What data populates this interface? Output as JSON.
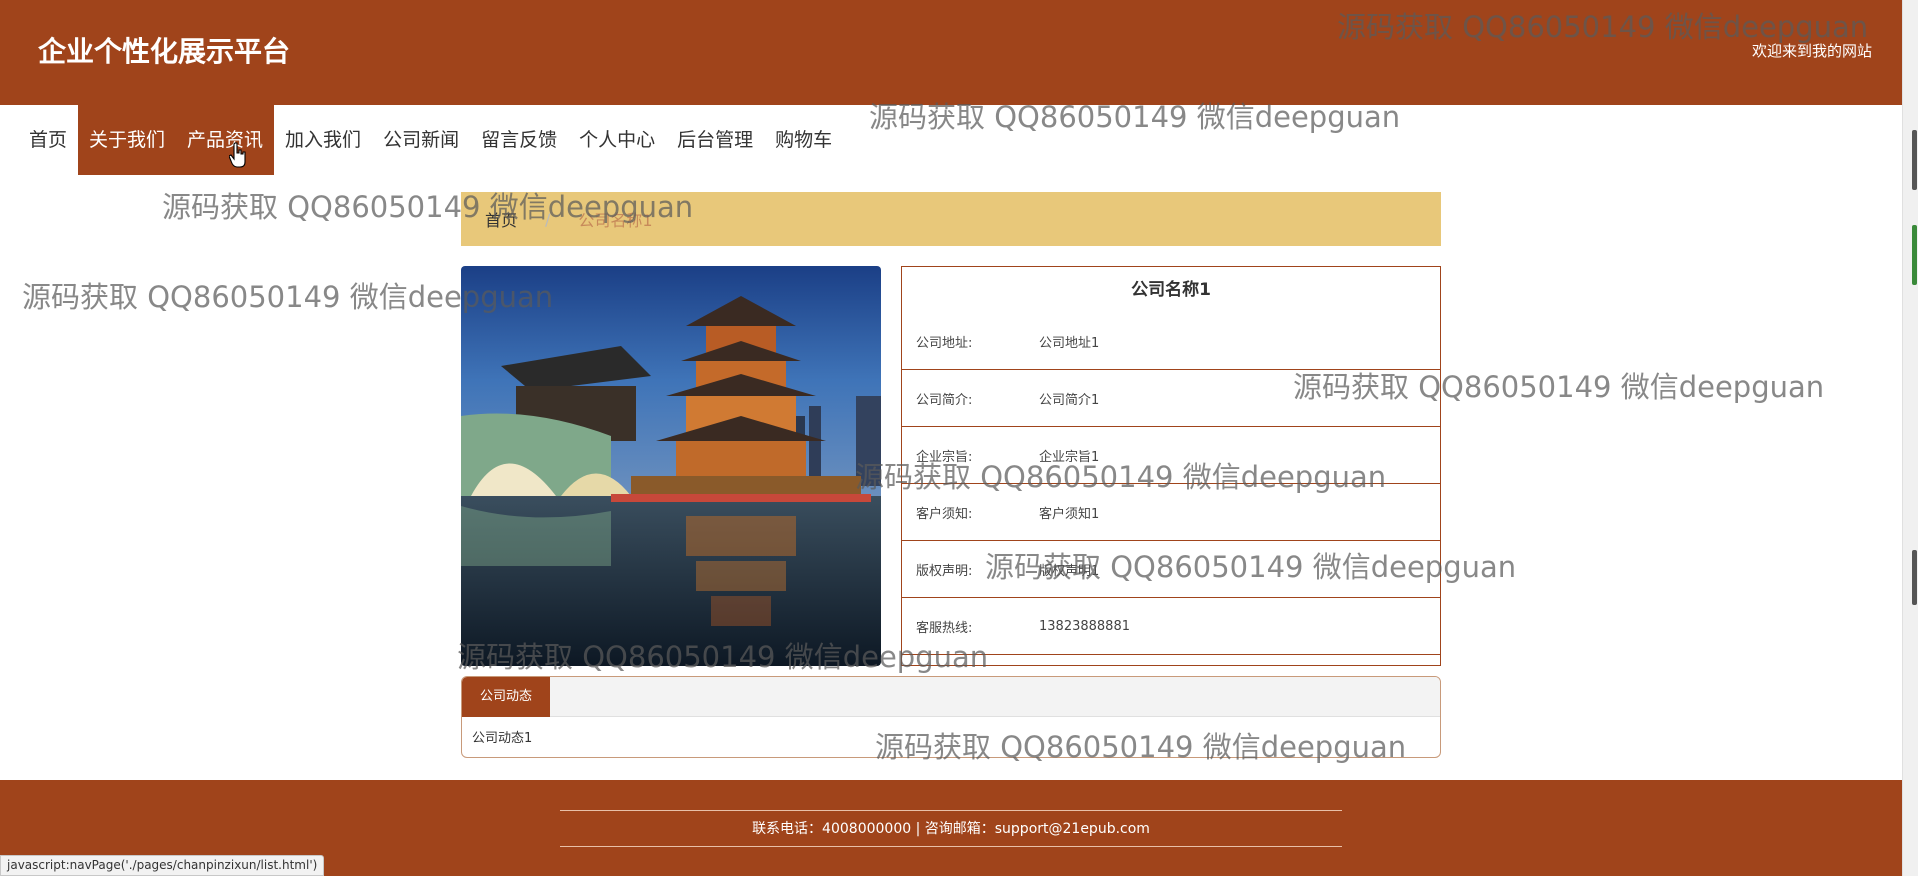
{
  "header": {
    "title": "企业个性化展示平台",
    "welcome": "欢迎来到我的网站"
  },
  "nav": {
    "items": [
      {
        "label": "首页"
      },
      {
        "label": "关于我们"
      },
      {
        "label": "产品资讯"
      },
      {
        "label": "加入我们"
      },
      {
        "label": "公司新闻"
      },
      {
        "label": "留言反馈"
      },
      {
        "label": "个人中心"
      },
      {
        "label": "后台管理"
      },
      {
        "label": "购物车"
      }
    ],
    "active_index": 1
  },
  "breadcrumb": {
    "home": "首页",
    "separator": "/",
    "current": "公司名称1"
  },
  "company": {
    "name": "公司名称1",
    "rows": [
      {
        "label": "公司地址:",
        "value": "公司地址1"
      },
      {
        "label": "公司简介:",
        "value": "公司简介1"
      },
      {
        "label": "企业宗旨:",
        "value": "企业宗旨1"
      },
      {
        "label": "客户须知:",
        "value": "客户须知1"
      },
      {
        "label": "版权声明:",
        "value": "版权声明1"
      },
      {
        "label": "客服热线:",
        "value": "13823888881"
      }
    ]
  },
  "news": {
    "tab": "公司动态",
    "items": [
      "公司动态1"
    ]
  },
  "footer": {
    "contact": "联系电话：4008000000 | 咨询邮箱：support@21epub.com"
  },
  "status_bar": {
    "text": "javascript:navPage('./pages/chanpinzixun/list.html')"
  },
  "watermark": {
    "text": "源码获取 QQ86050149 微信deepguan"
  },
  "colors": {
    "brand": "#a0441b",
    "breadcrumb_bg": "#e8c87a"
  }
}
